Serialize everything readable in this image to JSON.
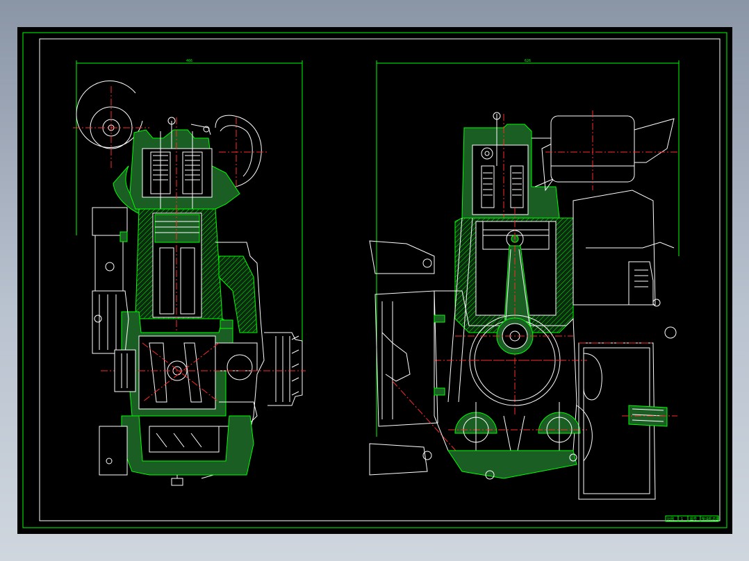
{
  "drawing": {
    "left_view": {
      "dimension_label": "466"
    },
    "right_view": {
      "dimension_label": "626"
    }
  },
  "title_block": {
    "cells": [
      "比例",
      "1",
      "图号",
      "柴油机总图"
    ]
  },
  "colors": {
    "background": "#000000",
    "outline": "#00ff00",
    "geometry": "#ffffff",
    "centerline": "#ff2a2a",
    "hatch": "#00ff00"
  }
}
